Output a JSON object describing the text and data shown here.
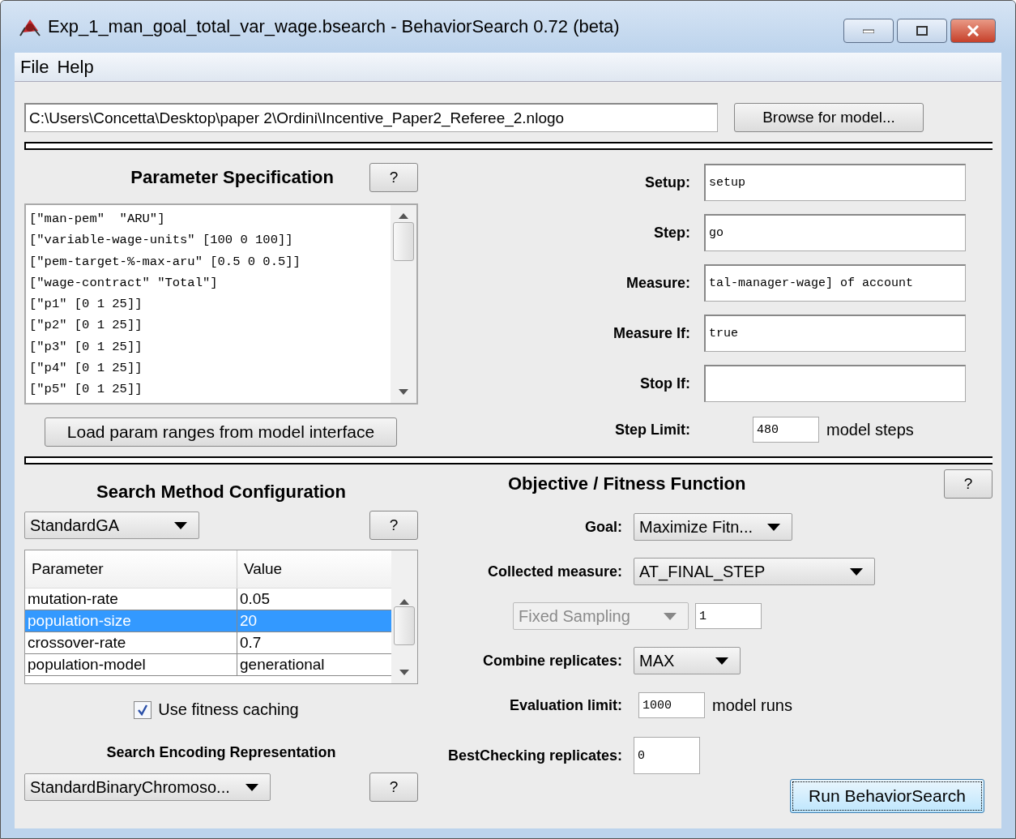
{
  "window": {
    "title": "Exp_1_man_goal_total_var_wage.bsearch - BehaviorSearch 0.72 (beta)"
  },
  "menu": [
    "File",
    "Help"
  ],
  "model_path": {
    "value": "C:\\Users\\Concetta\\Desktop\\paper 2\\Ordini\\Incentive_Paper2_Referee_2.nlogo",
    "button": "Browse for model..."
  },
  "parameter_spec": {
    "title": "Parameter Specification",
    "help": "?",
    "lines": [
      "[\"man-pem\"  \"ARU\"]",
      "[\"variable-wage-units\" [100 0 100]]",
      "[\"pem-target-%-max-aru\" [0.5 0 0.5]]",
      "[\"wage-contract\" \"Total\"]",
      "[\"p1\" [0 1 25]]",
      "[\"p2\" [0 1 25]]",
      "[\"p3\" [0 1 25]]",
      "[\"p4\" [0 1 25]]",
      "[\"p5\" [0 1 25]]"
    ],
    "load_button": "Load param ranges from model interface"
  },
  "commands": [
    {
      "label": "Setup:",
      "value": "setup"
    },
    {
      "label": "Step:",
      "value": "go"
    },
    {
      "label": "Measure:",
      "value": "tal-manager-wage] of account"
    },
    {
      "label": "Measure If:",
      "value": "true"
    },
    {
      "label": "Stop If:"
    }
  ],
  "step_limit": {
    "label": "Step Limit:",
    "value": "480",
    "unit": "model steps"
  },
  "search_method": {
    "title": "Search Method Configuration",
    "method": "StandardGA",
    "help": "?",
    "columns": [
      "Parameter",
      "Value"
    ],
    "rows": [
      {
        "parameter": "mutation-rate",
        "value": "0.05",
        "selected": false
      },
      {
        "parameter": "population-size",
        "value": "20",
        "selected": true
      },
      {
        "parameter": "crossover-rate",
        "value": "0.7",
        "selected": false
      },
      {
        "parameter": "population-model",
        "value": "generational",
        "selected": false
      }
    ],
    "caching": {
      "label": "Use fitness caching",
      "checked": true
    }
  },
  "encoding": {
    "title": "Search Encoding Representation",
    "value": "StandardBinaryChromoso...",
    "help": "?"
  },
  "objective": {
    "title": "Objective / Fitness Function",
    "help": "?",
    "goal": {
      "label": "Goal:",
      "value": "Maximize Fitn..."
    },
    "collected": {
      "label": "Collected measure:",
      "value": "AT_FINAL_STEP"
    },
    "sampling": {
      "value": "Fixed Sampling",
      "disabled": true,
      "count": "1"
    },
    "combine": {
      "label": "Combine replicates:",
      "value": "MAX"
    },
    "evaluation_limit": {
      "label": "Evaluation limit:",
      "value": "1000",
      "unit": "model runs"
    },
    "best_checking": {
      "label": "BestChecking replicates:",
      "value": "0"
    },
    "run_button": "Run BehaviorSearch"
  }
}
